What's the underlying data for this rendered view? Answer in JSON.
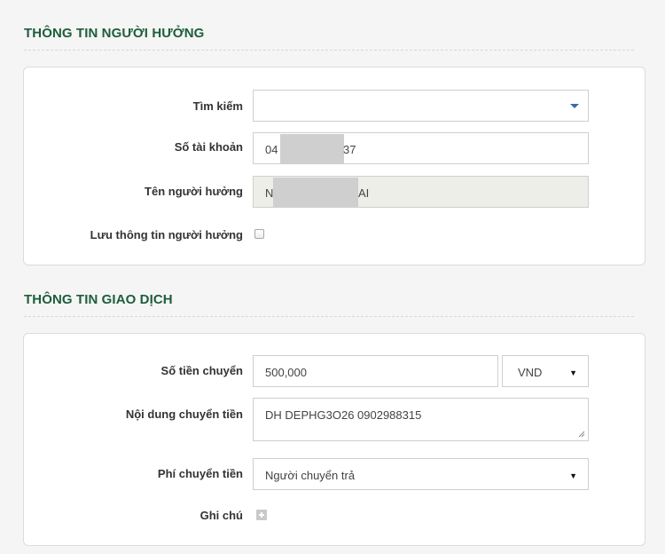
{
  "beneficiary": {
    "title": "THÔNG TIN NGƯỜI HƯỞNG",
    "search_label": "Tìm kiếm",
    "search_value": "",
    "account_label": "Số tài khoản",
    "account_prefix": "04",
    "account_suffix": "37",
    "name_label": "Tên người hưởng",
    "name_prefix": "N",
    "name_suffix": "AI",
    "save_label": "Lưu thông tin người hưởng"
  },
  "transaction": {
    "title": "THÔNG TIN GIAO DỊCH",
    "amount_label": "Số tiền chuyển",
    "amount_value": "500,000",
    "currency_value": "VND",
    "content_label": "Nội dung chuyển tiền",
    "content_value": "DH DEPHG3O26 0902988315",
    "fee_label": "Phí chuyển tiền",
    "fee_value": "Người chuyển trả",
    "note_label": "Ghi chú"
  },
  "colors": {
    "section_title": "#1d5e3c",
    "caret_blue": "#3a6aa6",
    "readonly_bg": "#eeeee9"
  },
  "icons": {
    "search_dropdown": "caret-down-icon",
    "select_arrow": "triangle-down-icon",
    "add_note": "plus-icon",
    "textarea_resize": "resize-handle-icon"
  }
}
